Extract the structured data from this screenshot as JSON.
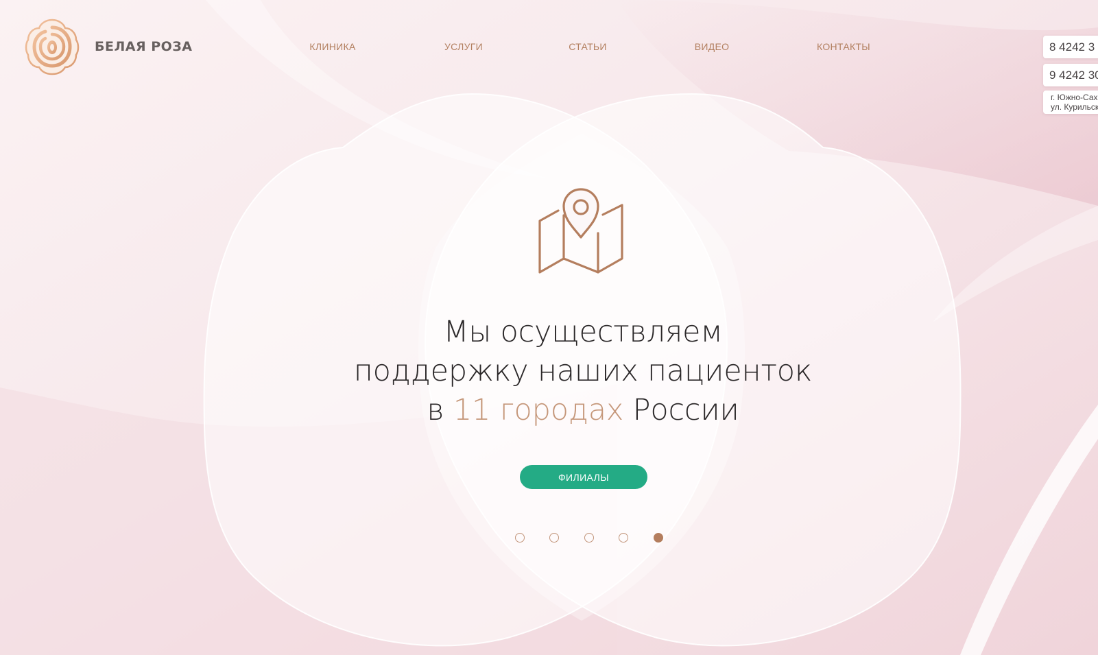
{
  "brand": {
    "name": "БЕЛАЯ РОЗА"
  },
  "nav": {
    "items": [
      {
        "label": "КЛИНИКА"
      },
      {
        "label": "УСЛУГИ"
      },
      {
        "label": "СТАТЬИ"
      },
      {
        "label": "ВИДЕО"
      },
      {
        "label": "КОНТАКТЫ"
      }
    ]
  },
  "contacts": {
    "phone_1": "8 4242 3",
    "phone_2": "9 4242 30",
    "address_line_1": "г. Южно-Сах",
    "address_line_2": "ул. Курильск"
  },
  "hero": {
    "icon": "map-pin-icon",
    "line_1": "Мы осуществляем",
    "line_2": "поддержку наших пациенток",
    "line_3_prefix": "в ",
    "line_3_accent": "11 городах",
    "line_3_suffix": " России",
    "button_label": "ФИЛИАЛЫ"
  },
  "slider": {
    "total": 5,
    "active_index": 4
  },
  "colors": {
    "accent": "#b47e5e",
    "nav_text": "#b27f5f",
    "button": "#24ab85",
    "headline_accent": "#c5977a",
    "background": "#f6e6ea"
  }
}
